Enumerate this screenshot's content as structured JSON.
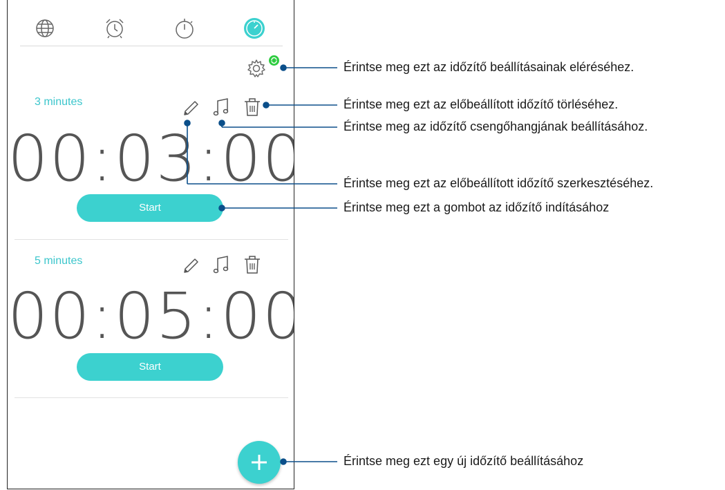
{
  "tabs": [
    {
      "name": "world-clock",
      "icon": "globe-icon"
    },
    {
      "name": "alarm",
      "icon": "alarm-clock-icon"
    },
    {
      "name": "stopwatch",
      "icon": "stopwatch-icon"
    },
    {
      "name": "timer",
      "icon": "timer-icon",
      "active": true
    }
  ],
  "colors": {
    "accent": "#3cd1cf",
    "badge": "#2ecc40",
    "callout": "#0b4f8a"
  },
  "timers": [
    {
      "name": "3 minutes",
      "time": "00:03:00",
      "start_label": "Start"
    },
    {
      "name": "5 minutes",
      "time": "00:05:00",
      "start_label": "Start"
    }
  ],
  "callouts": {
    "settings": "Érintse meg ezt az időzítő beállításainak eléréséhez.",
    "delete": "Érintse meg ezt az előbeállított időzítő törléséhez.",
    "ringtone": "Érintse meg az időzítő csengőhangjának beállításához.",
    "edit": "Érintse meg ezt az előbeállított időzítő szerkesztéséhez.",
    "start": "Érintse meg ezt a gombot az időzítő indításához",
    "add": "Érintse meg ezt egy új időzítő beállításához"
  }
}
